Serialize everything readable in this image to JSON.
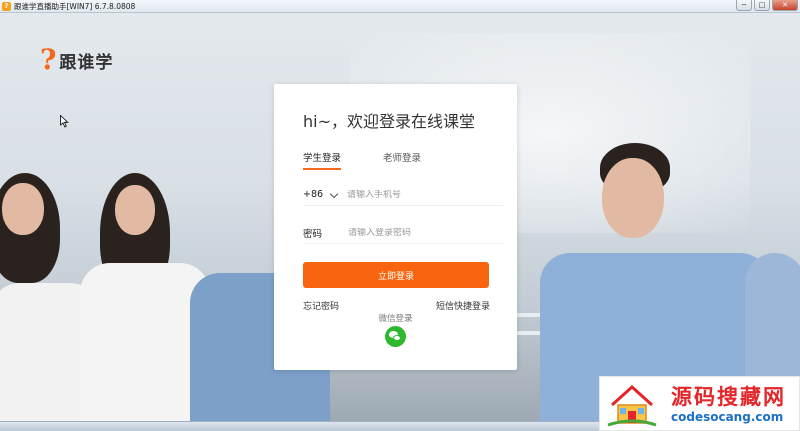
{
  "window": {
    "title": "跟谁学直播助手[WIN7] 6.7.8.0808",
    "controls": {
      "minimize": "−",
      "maximize": "□",
      "close": "✕"
    }
  },
  "logo": {
    "mark": "?",
    "text": "跟谁学"
  },
  "login": {
    "heading": "hi~，欢迎登录在线课堂",
    "tabs": [
      {
        "label": "学生登录",
        "active": true
      },
      {
        "label": "老师登录",
        "active": false
      }
    ],
    "phone": {
      "prefix": "+86",
      "placeholder": "请输入手机号"
    },
    "password": {
      "label": "密码",
      "placeholder": "请输入登录密码"
    },
    "submit_label": "立即登录",
    "forgot_label": "忘记密码",
    "sms_label": "短信快捷登录",
    "wechat_label": "微信登录"
  },
  "watermark": {
    "title": "源码搜藏网",
    "subtitle": "codesocang.com"
  },
  "colors": {
    "accent": "#f8650e",
    "wechat": "#2eb82e",
    "watermark_red": "#e4262a",
    "watermark_blue": "#1b6fc4"
  }
}
